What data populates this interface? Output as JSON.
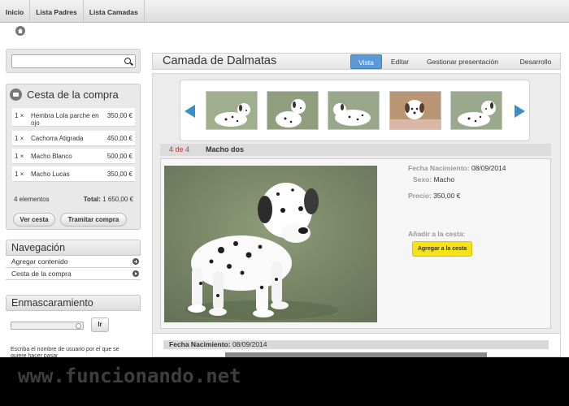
{
  "topnav": {
    "items": [
      "Inicio",
      "Lista Padres",
      "Lista Camadas"
    ]
  },
  "search": {
    "placeholder": ""
  },
  "cart": {
    "title": "Cesta de la compra",
    "items": [
      {
        "qty": "1 ×",
        "name": "Hembra Lola parche en ojo",
        "price": "350,00 €"
      },
      {
        "qty": "1 ×",
        "name": "Cachorra Atigrada",
        "price": "450,00 €"
      },
      {
        "qty": "1 ×",
        "name": "Macho Blanco",
        "price": "500,00 €"
      },
      {
        "qty": "1 ×",
        "name": "Macho Lucas",
        "price": "350,00 €"
      }
    ],
    "count": "4 elementos",
    "total_label": "Total:",
    "total_value": "1 650,00 €",
    "view_button": "Ver cesta",
    "checkout_button": "Tramitar compra"
  },
  "navigation": {
    "title": "Navegación",
    "items": [
      "Agregar contenido",
      "Cesta de la compra"
    ]
  },
  "masking": {
    "title": "Enmascaramiento",
    "button": "Ir",
    "help": "Escriba el nombre de usuario por el que se quiere hacer pasar"
  },
  "main": {
    "title": "Camada de Dalmatas",
    "tabs": [
      "Vista",
      "Editar",
      "Gestionar presentación",
      "Desarrollo"
    ],
    "active_tab": "Vista"
  },
  "detail": {
    "pager": "4 de 4",
    "name": "Macho dos",
    "birth_label": "Fecha Nacimiento:",
    "birth_value": "08/09/2014",
    "sex_label": "Sexo:",
    "sex_value": "Macho",
    "price_label": "Precio:",
    "price_value": "350,00 €",
    "add_label": "Añadir a la cesta:",
    "add_button": "Agregar a la cesta"
  },
  "bottom": {
    "birth_label": "Fecha Nacimiento:",
    "birth_value": "08/09/2014"
  },
  "watermark": "www.funcionando.net",
  "colors": {
    "tab_active": "#5b9ad7",
    "carousel_arrow": "#3a8fc9",
    "add_button": "#f4e21c",
    "pager_number": "#c0392b",
    "photo_background": "#7f8c68"
  }
}
